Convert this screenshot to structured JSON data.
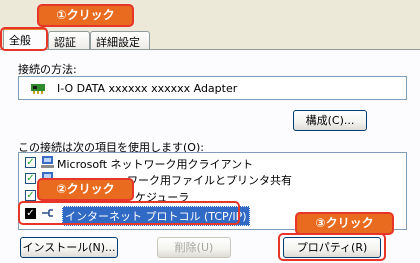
{
  "tabs": [
    {
      "label": "全般",
      "active": true
    },
    {
      "label": "認証",
      "active": false
    },
    {
      "label": "詳細設定",
      "active": false
    }
  ],
  "connect_using_label": "接続の方法:",
  "adapter_name": "I-O DATA xxxxxx xxxxxx Adapter",
  "configure_button": "構成(C)...",
  "items_label": "この接続は次の項目を使用します(O):",
  "items": [
    {
      "label": "Microsoft ネットワーク用クライアント",
      "checked": true
    },
    {
      "label": "ワーク用ファイルとプリンタ共有",
      "checked": true
    },
    {
      "label": "ケジューラ",
      "checked": true
    },
    {
      "label": "インターネット プロトコル (TCP/IP)",
      "checked": true,
      "selected": true
    }
  ],
  "buttons": {
    "install": "インストール(N)...",
    "uninstall": "削除(U)",
    "properties": "プロパティ(R)"
  },
  "callouts": {
    "step1": "①クリック",
    "step2": "②クリック",
    "step3": "③クリック"
  },
  "colors": {
    "callout_fill": "#e96b1f",
    "callout_border": "#e8352a",
    "selection": "#316ac5"
  }
}
